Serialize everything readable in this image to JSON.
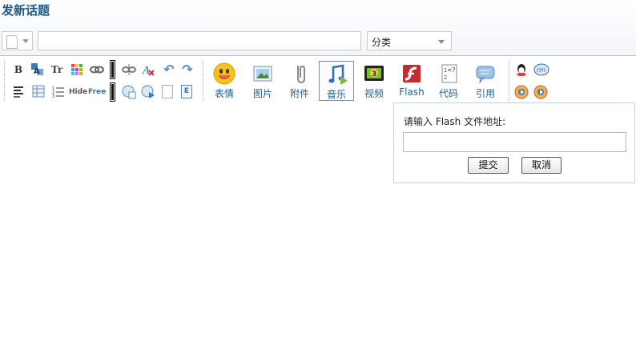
{
  "page": {
    "title": "发新话题"
  },
  "subject": {
    "value": "",
    "placeholder": ""
  },
  "category": {
    "selected": "分类"
  },
  "toolbar": {
    "small_row1": [
      {
        "icon": "bold-icon",
        "glyph": "B"
      },
      {
        "icon": "text-color-icon",
        "glyph": "A"
      },
      {
        "icon": "font-size-icon",
        "glyph": "Tr"
      },
      {
        "icon": "background-color-icon",
        "glyph": ""
      },
      {
        "icon": "link-icon",
        "glyph": ""
      },
      {
        "icon": "unlink-icon",
        "glyph": ""
      },
      {
        "icon": "remove-format-icon",
        "glyph": "A"
      },
      {
        "icon": "undo-icon",
        "glyph": "↶"
      },
      {
        "icon": "redo-icon",
        "glyph": "↷"
      }
    ],
    "small_row2": [
      {
        "icon": "align-icon",
        "glyph": "≡"
      },
      {
        "icon": "table-icon",
        "glyph": ""
      },
      {
        "icon": "list-icon",
        "glyph": ""
      },
      {
        "icon": "hide-icon",
        "glyph": "Hide"
      },
      {
        "icon": "free-icon",
        "glyph": "Free"
      },
      {
        "icon": "insert-image-icon",
        "glyph": ""
      },
      {
        "icon": "insert-media-icon",
        "glyph": ""
      },
      {
        "icon": "page-icon",
        "glyph": ""
      },
      {
        "icon": "index-icon",
        "glyph": "E"
      }
    ],
    "big": [
      {
        "label": "表情",
        "icon": "smiley-icon"
      },
      {
        "label": "图片",
        "icon": "picture-icon"
      },
      {
        "label": "附件",
        "icon": "attachment-icon"
      },
      {
        "label": "音乐",
        "icon": "music-icon",
        "active": true
      },
      {
        "label": "视频",
        "icon": "video-icon"
      },
      {
        "label": "Flash",
        "icon": "flash-icon"
      },
      {
        "label": "代码",
        "icon": "code-icon"
      },
      {
        "label": "引用",
        "icon": "quote-icon"
      }
    ],
    "extra": [
      {
        "icon": "qq-icon"
      },
      {
        "icon": "rm-icon"
      },
      {
        "icon": "audio-play-icon"
      },
      {
        "icon": "video-play-icon"
      }
    ]
  },
  "flash_popup": {
    "label": "请输入 Flash 文件地址:",
    "input_value": "",
    "submit_label": "提交",
    "cancel_label": "取消"
  },
  "colors": {
    "title": "#1a5a8a",
    "label": "#1f5f8f",
    "border": "#c9c9c9"
  }
}
